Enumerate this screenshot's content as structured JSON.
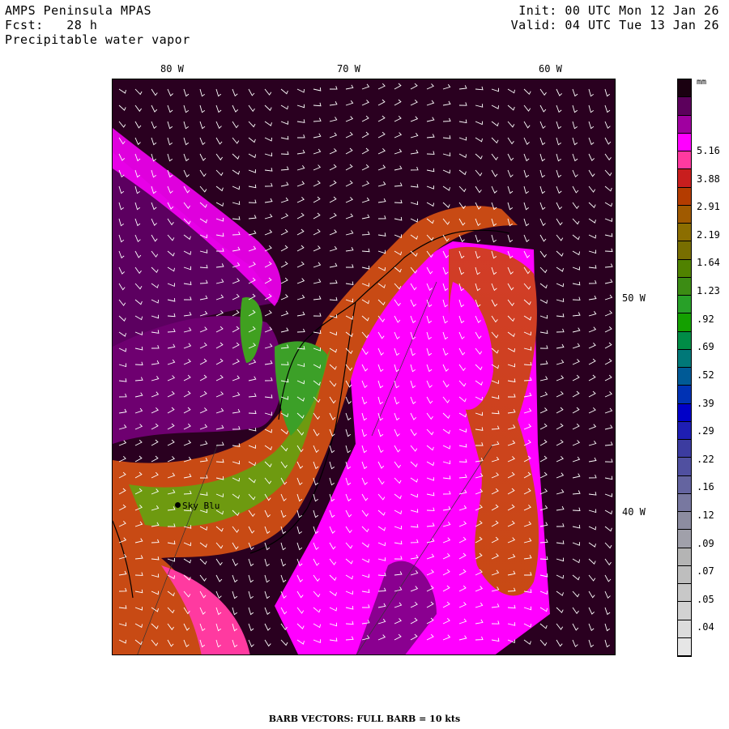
{
  "header": {
    "model": "AMPS Peninsula MPAS",
    "forecast_label": "Fcst:",
    "forecast_hours": "28 h",
    "field": "Precipitable water vapor",
    "init": "Init: 00 UTC Mon 12 Jan 26",
    "valid": "Valid: 04 UTC Tue 13 Jan 26"
  },
  "longitude_labels": [
    "80 W",
    "70 W",
    "60 W"
  ],
  "latitude_labels": [
    "50 W",
    "40 W"
  ],
  "station": {
    "name": "Sky Blu"
  },
  "colorbar": {
    "unit": "mm",
    "colors": [
      "#1a0010",
      "#5c005c",
      "#a000a0",
      "#ff00ff",
      "#ff3aa0",
      "#c81e1e",
      "#b43c00",
      "#a05a00",
      "#8c6e00",
      "#786e00",
      "#508200",
      "#3c8c14",
      "#28a028",
      "#14a000",
      "#008c46",
      "#007878",
      "#005a96",
      "#0032b4",
      "#0000c8",
      "#1e1eb4",
      "#3c3ca0",
      "#5050a0",
      "#6464a0",
      "#7878a0",
      "#8c8ca0",
      "#a0a0aa",
      "#b4b4b4",
      "#bebebe",
      "#c8c8c8",
      "#d2d2d2",
      "#dcdcdc",
      "#e6e6e6"
    ],
    "labels": [
      "5.16",
      "3.88",
      "2.91",
      "2.19",
      "1.64",
      "1.23",
      ".92",
      ".69",
      ".52",
      ".39",
      ".29",
      ".22",
      ".16",
      ".12",
      ".09",
      ".07",
      ".05",
      ".04"
    ]
  },
  "footer": "BARB VECTORS:  FULL BARB = 10 kts"
}
